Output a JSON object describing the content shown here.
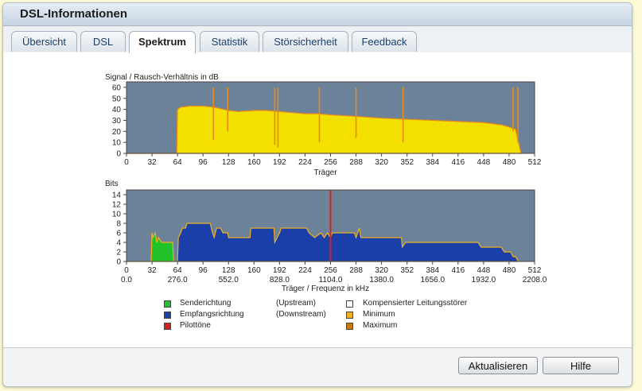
{
  "window": {
    "title": "DSL-Informationen"
  },
  "tabs": [
    {
      "label": "Übersicht",
      "active": false
    },
    {
      "label": "DSL",
      "active": false
    },
    {
      "label": "Spektrum",
      "active": true
    },
    {
      "label": "Statistik",
      "active": false
    },
    {
      "label": "Störsicherheit",
      "active": false
    },
    {
      "label": "Feedback",
      "active": false
    }
  ],
  "colors": {
    "plot_bg": "#6c8299",
    "snr_fill": "#f4e000",
    "snr_line": "#e88a1a",
    "upstream": "#22c22a",
    "downstream": "#1a3fa8",
    "pilot": "#d42020",
    "minimum": "#f0b020",
    "maximum": "#c87a10"
  },
  "chart_data": [
    {
      "type": "area",
      "ylabel": "Signal / Rausch-Verhältnis in dB",
      "xlabel": "Träger",
      "xlim": [
        0,
        512
      ],
      "ylim": [
        0,
        65
      ],
      "yticks": [
        "0",
        "10",
        "20",
        "30",
        "40",
        "50",
        "60"
      ],
      "xticks": [
        "0",
        "32",
        "64",
        "96",
        "128",
        "160",
        "192",
        "224",
        "256",
        "288",
        "320",
        "352",
        "384",
        "416",
        "448",
        "480",
        "512"
      ],
      "grid": false,
      "series": [
        {
          "x": [
            0,
            63,
            64,
            68,
            80,
            96,
            110,
            128,
            140,
            160,
            176,
            192,
            208,
            224,
            240,
            256,
            280,
            300,
            320,
            352,
            384,
            416,
            448,
            470,
            480,
            488,
            495
          ],
          "values": [
            0,
            0,
            40,
            42,
            43,
            43,
            42,
            39,
            38,
            39,
            39,
            38,
            37,
            36,
            36,
            35,
            34,
            33,
            32,
            31,
            30,
            29,
            28,
            26,
            24,
            22,
            0
          ],
          "dips": [
            {
              "x": 109,
              "value": 12
            },
            {
              "x": 127,
              "value": 20
            },
            {
              "x": 186,
              "value": 8
            },
            {
              "x": 190,
              "value": 5
            },
            {
              "x": 242,
              "value": 10
            },
            {
              "x": 288,
              "value": 14
            },
            {
              "x": 347,
              "value": 10
            },
            {
              "x": 485,
              "value": 20
            },
            {
              "x": 491,
              "value": 10
            }
          ]
        }
      ]
    },
    {
      "type": "area",
      "ylabel": "Bits",
      "xlabel": "Träger / Frequenz in kHz",
      "xlim": [
        0,
        512
      ],
      "ylim": [
        0,
        15
      ],
      "yticks": [
        "0",
        "2",
        "4",
        "6",
        "8",
        "10",
        "12",
        "14"
      ],
      "xticks": [
        "0",
        "32",
        "64",
        "96",
        "128",
        "160",
        "192",
        "224",
        "256",
        "288",
        "320",
        "352",
        "384",
        "416",
        "448",
        "480",
        "512"
      ],
      "xticks_khz": [
        "0.0",
        "276.0",
        "552.0",
        "828.0",
        "1104.0",
        "1380.0",
        "1656.0",
        "1932.0",
        "2208.0"
      ],
      "grid": false,
      "pilot_x": 256,
      "series": [
        {
          "name": "Senderichtung",
          "x": [
            0,
            31,
            32,
            33,
            36,
            38,
            40,
            44,
            58,
            59
          ],
          "values": [
            0,
            0,
            6,
            5,
            6,
            4,
            5,
            4,
            4,
            0
          ]
        },
        {
          "name": "Empfangsrichtung",
          "x": [
            64,
            65,
            68,
            70,
            74,
            76,
            105,
            108,
            110,
            113,
            118,
            121,
            127,
            128,
            155,
            156,
            185,
            186,
            192,
            194,
            226,
            229,
            236,
            244,
            248,
            252,
            256,
            258,
            286,
            288,
            292,
            294,
            345,
            346,
            350,
            352,
            441,
            445,
            470,
            474,
            482,
            485,
            488,
            492,
            496
          ],
          "values": [
            0,
            5,
            6,
            7,
            7,
            8,
            8,
            6,
            5,
            7,
            7,
            6,
            6,
            5,
            5,
            7,
            7,
            4,
            6,
            7,
            7,
            6,
            5,
            6,
            5,
            6,
            5,
            6,
            6,
            5,
            7,
            5,
            5,
            3,
            4,
            4,
            4,
            3,
            3,
            2,
            2,
            1,
            1,
            0,
            0
          ]
        }
      ]
    }
  ],
  "legend": {
    "upstream_label": "Senderichtung",
    "upstream_note": "(Upstream)",
    "downstream_label": "Empfangsrichtung",
    "downstream_note": "(Downstream)",
    "pilot_label": "Pilottöne",
    "comp_label": "Kompensierter Leitungsstörer",
    "min_label": "Minimum",
    "max_label": "Maximum"
  },
  "buttons": {
    "refresh": "Aktualisieren",
    "help": "Hilfe"
  }
}
